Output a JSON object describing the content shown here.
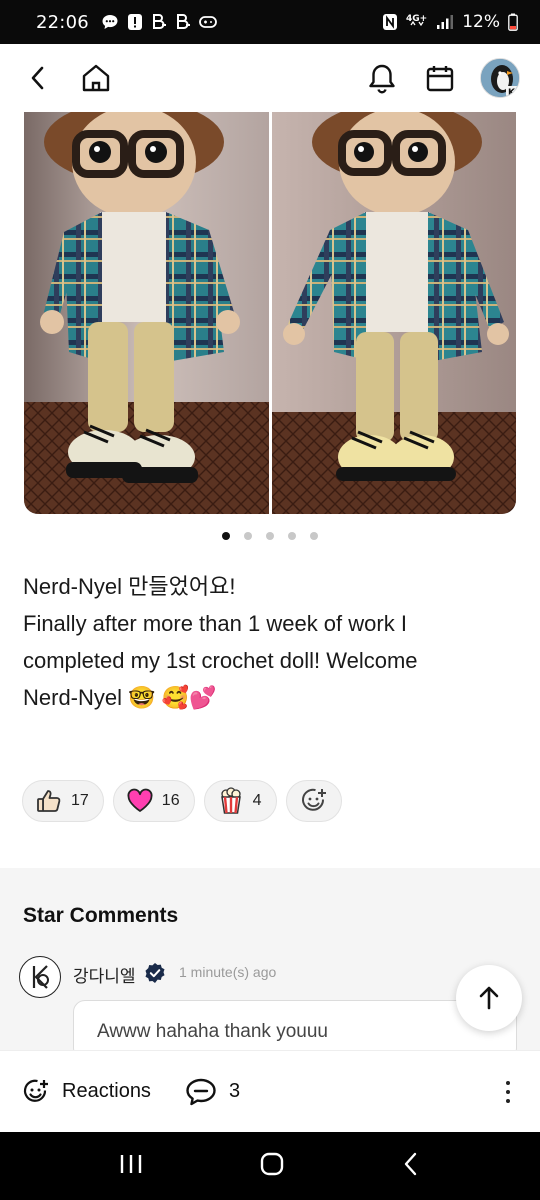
{
  "status_bar": {
    "time": "22:06",
    "network": "4G+",
    "battery": "12%",
    "left_icons": [
      "chat-bubble-icon",
      "alert-icon",
      "b-app-icon",
      "b-app-icon",
      "game-controller-icon"
    ],
    "right_icons": [
      "nfc-icon",
      "4g-icon",
      "signal-icon",
      "battery-icon"
    ]
  },
  "header": {
    "icons": [
      "back-icon",
      "home-icon",
      "bell-icon",
      "calendar-icon",
      "avatar"
    ]
  },
  "carousel": {
    "photo_count": 5,
    "active_index": 0
  },
  "post": {
    "lines": [
      "Nerd-Nyel 만들었어요!",
      "Finally after more than 1 week of work I",
      "completed my 1st crochet doll! Welcome",
      "Nerd-Nyel 🤓 🥰💕"
    ]
  },
  "reactions": [
    {
      "icon": "thumbs-up-icon",
      "count": "17"
    },
    {
      "icon": "heart-icon",
      "count": "16"
    },
    {
      "icon": "popcorn-icon",
      "count": "4"
    }
  ],
  "comments": {
    "title": "Star Comments",
    "author": "강다니엘",
    "time": "1 minute(s) ago",
    "text": "Awww hahaha thank youuu"
  },
  "bottom_bar": {
    "reactions_label": "Reactions",
    "comment_count": "3"
  },
  "colors": {
    "heart": "#ff3fb0",
    "status_bar_bg": "#0a0a0a",
    "section_bg": "#f5f5f5"
  }
}
